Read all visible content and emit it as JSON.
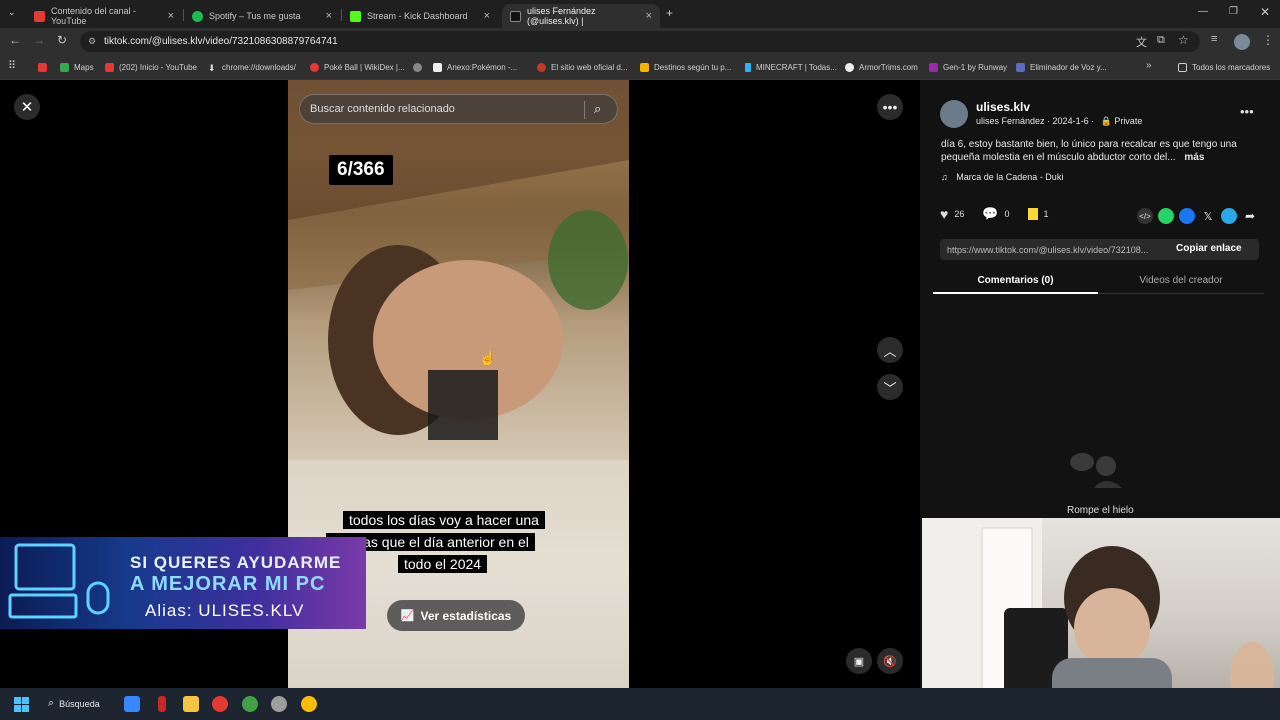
{
  "browser": {
    "tabs": [
      {
        "title": "Contenido del canal - YouTube",
        "color": "#e53935"
      },
      {
        "title": "Spotify – Tus me gusta",
        "color": "#1db954"
      },
      {
        "title": "Stream - Kick Dashboard",
        "color": "#53fc18"
      },
      {
        "title": "ulises Fernández (@ulises.klv) |",
        "color": "#000000"
      }
    ],
    "url": "tiktok.com/@ulises.klv/video/7321086308879764741",
    "bookmarks": [
      "Maps",
      "(202) Inicio - YouTube",
      "chrome://downloads/",
      "Poké Ball | WikiDex |...",
      "Anexo:Pokémon -...",
      "El sitio web oficial d...",
      "Destinos según tu p...",
      "MINECRAFT | Todas...",
      "ArmorTrims.com",
      "Gen-1 by Runway",
      "Eliminador de Voz y..."
    ],
    "all_bookmarks": "Todos los marcadores"
  },
  "video": {
    "search_placeholder": "Buscar contenido relacionado",
    "counter": "6/366",
    "caption_lines": [
      "todos los días voy a hacer una",
      "ón mas que el día anterior en el",
      "todo el 2024"
    ],
    "stats_button": "Ver estadísticas"
  },
  "promo": {
    "line1": "SI QUERES AYUDARME",
    "line2": "A MEJORAR MI PC",
    "line3": "Alias: ULISES.KLV"
  },
  "panel": {
    "username": "ulises.klv",
    "display_name": "ulises Fernández",
    "date": "2024-1-6",
    "privacy": "Private",
    "description": "día 6, estoy bastante bien, lo único para recalcar es que tengo una pequeña molestia en el músculo abductor corto del...",
    "more": "más",
    "music": "Marca de la Cadena - Duki",
    "likes": "26",
    "comments": "0",
    "saves": "1",
    "link": "https://www.tiktok.com/@ulises.klv/video/732108...",
    "copy_link": "Copiar enlace",
    "tab_comments": "Comentarios (0)",
    "tab_videos": "Videos del creador",
    "empty_text": "Rompe el hielo"
  },
  "taskbar": {
    "search": "Búsqueda"
  }
}
